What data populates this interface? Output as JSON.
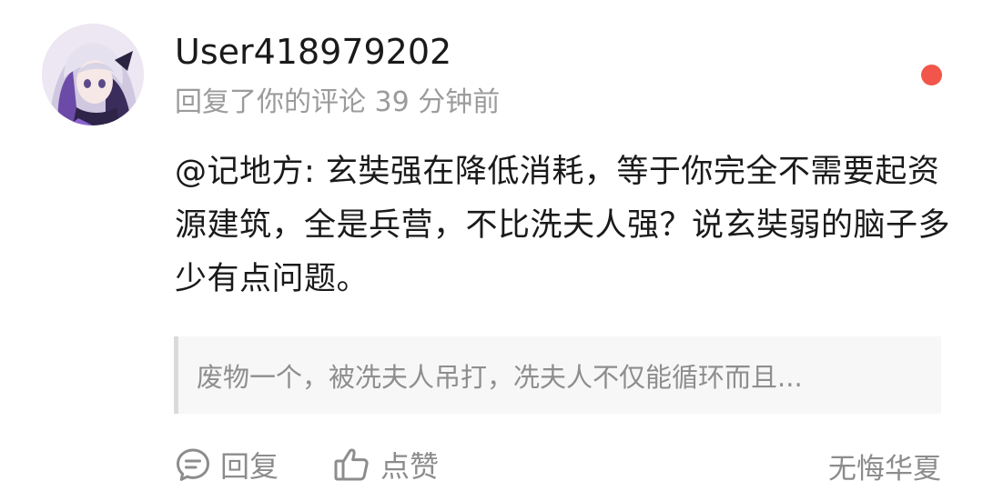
{
  "comment": {
    "username": "User418979202",
    "meta": "回复了你的评论 39 分钟前",
    "text": "@记地方: 玄奘强在降低消耗，等于你完全不需要起资源建筑，全是兵营，不比洗夫人强？说玄奘弱的脑子多少有点问题。",
    "quoted": "废物一个，被冼夫人吊打，冼夫人不仅能循环而且...",
    "avatar_icon": "anime-girl-avatar",
    "unread_color": "#f2564a"
  },
  "actions": {
    "reply_label": "回复",
    "reply_icon": "chat-bubble-icon",
    "like_label": "点赞",
    "like_icon": "thumbs-up-icon"
  },
  "source": "无悔华夏"
}
